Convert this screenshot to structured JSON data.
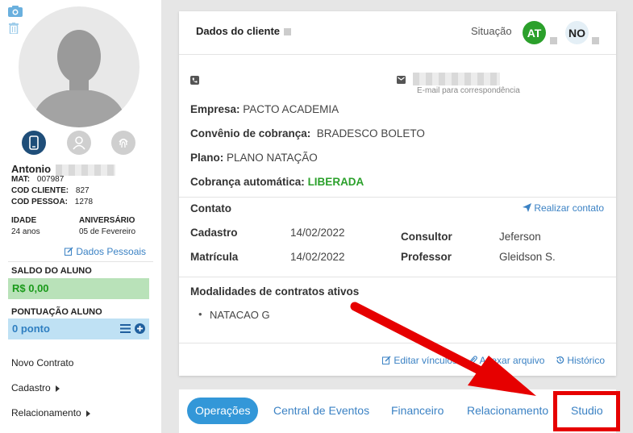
{
  "client": {
    "name": "Antonio",
    "mat_label": "MAT:",
    "mat": "007987",
    "cod_cliente_label": "COD CLIENTE:",
    "cod_cliente": "827",
    "cod_pessoa_label": "COD PESSOA:",
    "cod_pessoa": "1278",
    "idade_label": "IDADE",
    "idade": "24 anos",
    "aniversario_label": "ANIVERSÁRIO",
    "aniversario": "05 de Fevereiro",
    "dados_pessoais_link": "Dados Pessoais"
  },
  "saldo": {
    "label": "SALDO DO ALUNO",
    "value": "R$ 0,00"
  },
  "pontuacao": {
    "label": "PONTUAÇÃO ALUNO",
    "value": "0 ponto"
  },
  "sidebar_menu": {
    "novo_contrato": "Novo Contrato",
    "cadastro": "Cadastro",
    "relacionamento": "Relacionamento"
  },
  "card": {
    "title": "Dados do cliente",
    "situacao_label": "Situação",
    "badge_at": "AT",
    "badge_no": "NO",
    "email_note": "E-mail para correspondência",
    "empresa_label": "Empresa:",
    "empresa": "PACTO ACADEMIA",
    "convenio_label": "Convênio de cobrança:",
    "convenio": "BRADESCO BOLETO",
    "plano_label": "Plano:",
    "plano": "PLANO NATAÇÃO",
    "cobranca_label": "Cobrança automática:",
    "cobranca": "LIBERADA",
    "contato_label": "Contato",
    "realizar_contato": "Realizar contato",
    "cadastro_label": "Cadastro",
    "cadastro_date": "14/02/2022",
    "matricula_label": "Matrícula",
    "matricula_date": "14/02/2022",
    "consultor_label": "Consultor",
    "consultor": "Jeferson",
    "professor_label": "Professor",
    "professor": "Gleidson S.",
    "modalidades_label": "Modalidades de contratos ativos",
    "modalidade_item": "NATACAO G",
    "editar_vinculos": "Editar vínculos",
    "anexar_arquivo": "Anexar arquivo",
    "historico": "Histórico"
  },
  "tabs": {
    "operacoes": "Operações",
    "central_eventos": "Central de Eventos",
    "financeiro": "Financeiro",
    "relacionamento": "Relacionamento",
    "studio": "Studio"
  },
  "colors": {
    "accent": "#3b82c4",
    "active_tab": "#3397d8",
    "status_green": "#2ba02b",
    "highlight_red": "#e60000"
  }
}
